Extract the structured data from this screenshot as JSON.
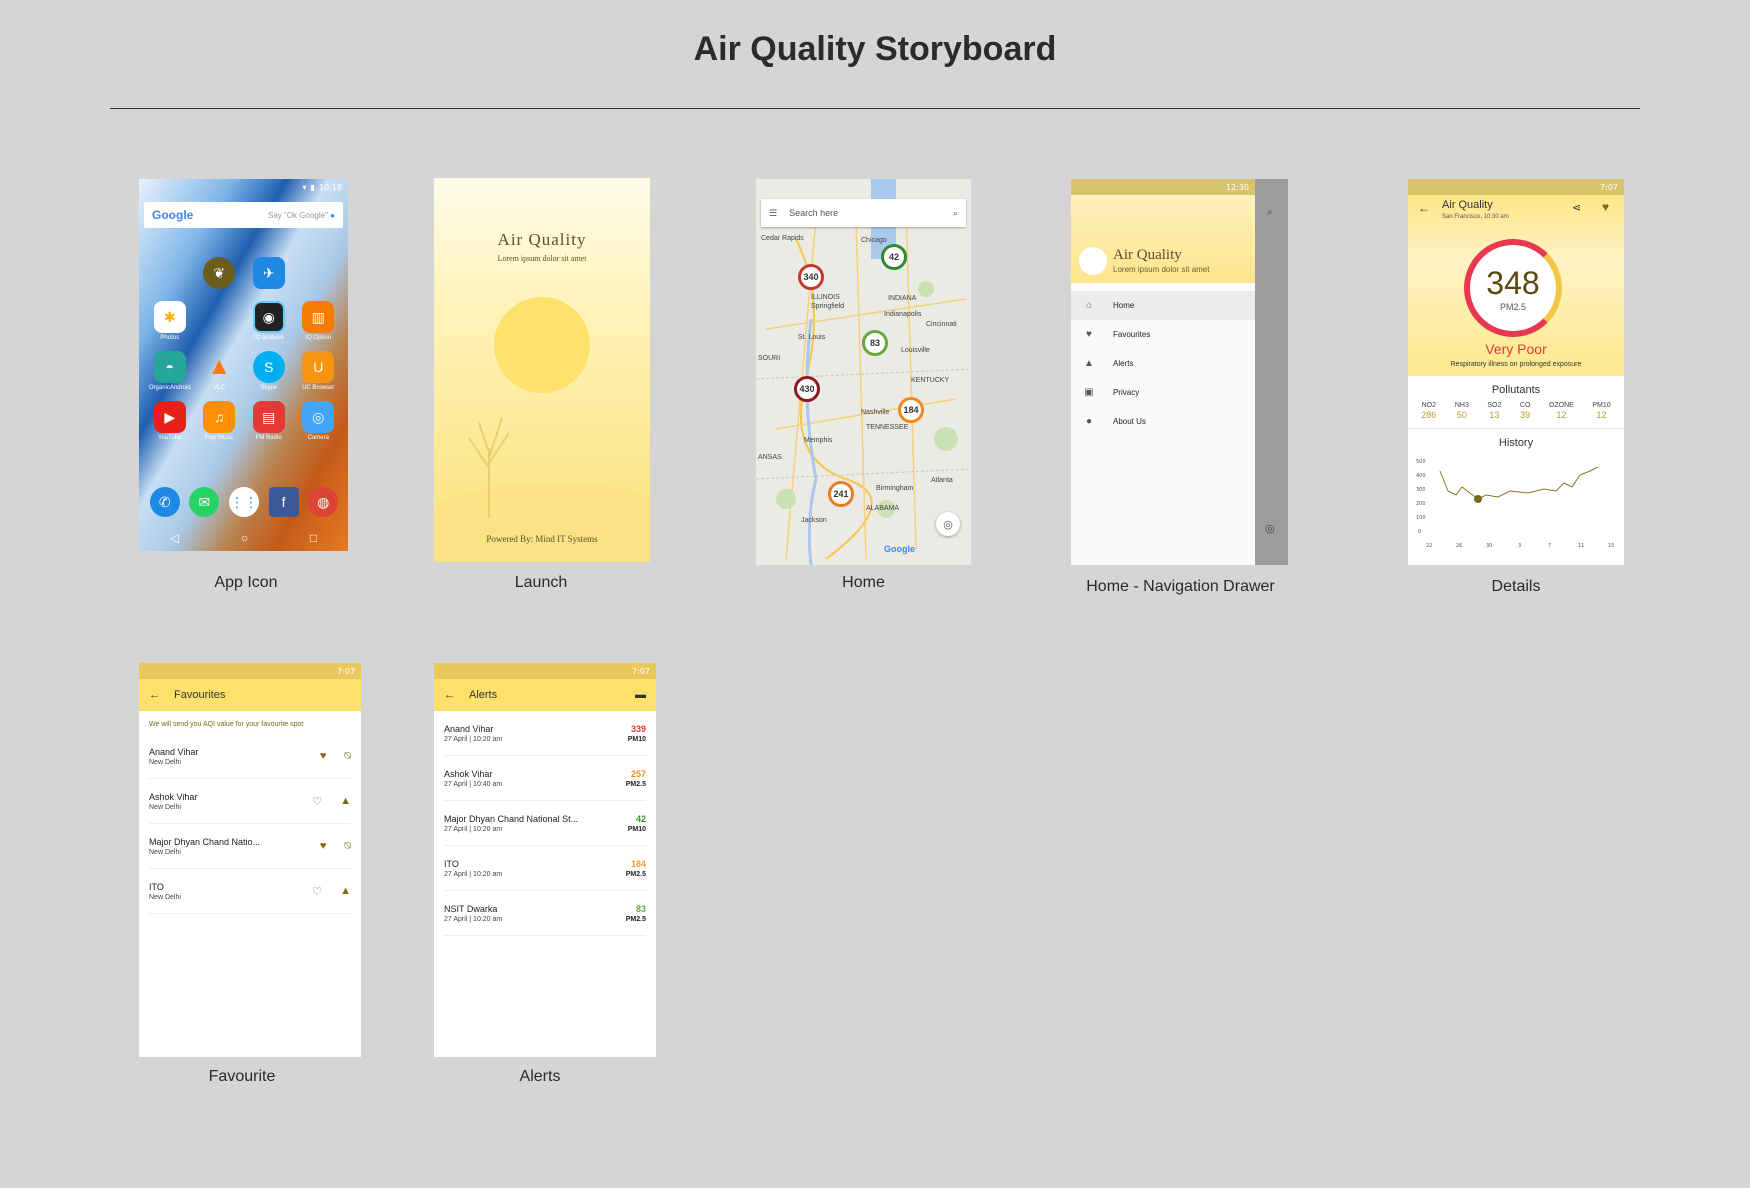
{
  "title": "Air Quality Storyboard",
  "captions": {
    "app_icon": "App Icon",
    "launch": "Launch",
    "home": "Home",
    "drawer": "Home - Navigation Drawer",
    "details": "Details",
    "favourite": "Favourite",
    "alerts": "Alerts"
  },
  "app_icon_screen": {
    "time": "10:18",
    "search_logo": "Google",
    "search_hint": "Say \"Ok Google\"",
    "apps": [
      "",
      "",
      "Photos",
      "",
      "IQ analysis",
      "IQ Option",
      "OrganicAndroid",
      "VLC",
      "Skype",
      "UC Browser",
      "YouTube",
      "Play Music",
      "FM Radio",
      "Camera"
    ]
  },
  "launch_screen": {
    "brand": "Air Quality",
    "tagline": "Lorem ipsum dolor sit amet",
    "powered_by": "Powered By: Mind IT Systems"
  },
  "home_screen": {
    "search_placeholder": "Search here",
    "pins": [
      "340",
      "42",
      "83",
      "430",
      "184",
      "241"
    ],
    "map_labels": [
      "Chicago",
      "ILLINOIS",
      "Springfield",
      "INDIANA",
      "Indianapolis",
      "Cincinnati",
      "St. Louis",
      "Louisville",
      "KENTUCKY",
      "Nashville",
      "TENNESSEE",
      "Memphis",
      "Birmingham",
      "ALABAMA",
      "Atlanta",
      "Cedar Rapids",
      "Jackson",
      "SOURI",
      "ANSAS",
      "Google"
    ]
  },
  "drawer_screen": {
    "time": "12:30",
    "brand": "Air Quality",
    "tagline": "Lorem ipsum dolor sit amet",
    "items": [
      "Home",
      "Favourites",
      "Alerts",
      "Privacy",
      "About Us"
    ]
  },
  "details_screen": {
    "time": "7:07",
    "title": "Air Quality",
    "subtitle": "San Francisco, 10:30 am",
    "aqi": "348",
    "unit": "PM2.5",
    "status": "Very Poor",
    "status_note": "Respiratory illness on prolonged exposure",
    "pollutants_title": "Pollutants",
    "pollutants": [
      {
        "name": "NO2",
        "value": "286"
      },
      {
        "name": "NH3",
        "value": "50"
      },
      {
        "name": "SO2",
        "value": "13"
      },
      {
        "name": "CO",
        "value": "39"
      },
      {
        "name": "OZONE",
        "value": "12"
      },
      {
        "name": "PM10",
        "value": "12"
      }
    ],
    "history_title": "History",
    "history_y": [
      "500",
      "400",
      "300",
      "200",
      "100",
      "0"
    ],
    "history_x": [
      "22",
      "26",
      "30",
      "3",
      "7",
      "11",
      "15"
    ]
  },
  "favourites_screen": {
    "time": "7:07",
    "title": "Favourites",
    "note": "We will send you AQI value for your favourite spot",
    "rows": [
      {
        "name": "Anand Vihar",
        "city": "New Delhi"
      },
      {
        "name": "Ashok Vihar",
        "city": "New Delhi"
      },
      {
        "name": "Major Dhyan Chand Natio...",
        "city": "New Delhi"
      },
      {
        "name": "ITO",
        "city": "New Delhi"
      }
    ]
  },
  "alerts_screen": {
    "time": "7:07",
    "title": "Alerts",
    "rows": [
      {
        "name": "Anand Vihar",
        "date": "27 April | 10:20 am",
        "value": "339",
        "unit": "PM10",
        "color": "#e53935"
      },
      {
        "name": "Ashok Vihar",
        "date": "27 April | 10:40 am",
        "value": "257",
        "unit": "PM2.5",
        "color": "#ef8a1a"
      },
      {
        "name": "Major Dhyan Chand National St...",
        "date": "27 April | 10:20 am",
        "value": "42",
        "unit": "PM10",
        "color": "#2e9a2e"
      },
      {
        "name": "ITO",
        "date": "27 April | 10:20 am",
        "value": "184",
        "unit": "PM2.5",
        "color": "#f0a030"
      },
      {
        "name": "NSIT Dwarka",
        "date": "27 April | 10:20 am",
        "value": "83",
        "unit": "PM2.5",
        "color": "#6aa63a"
      }
    ]
  }
}
